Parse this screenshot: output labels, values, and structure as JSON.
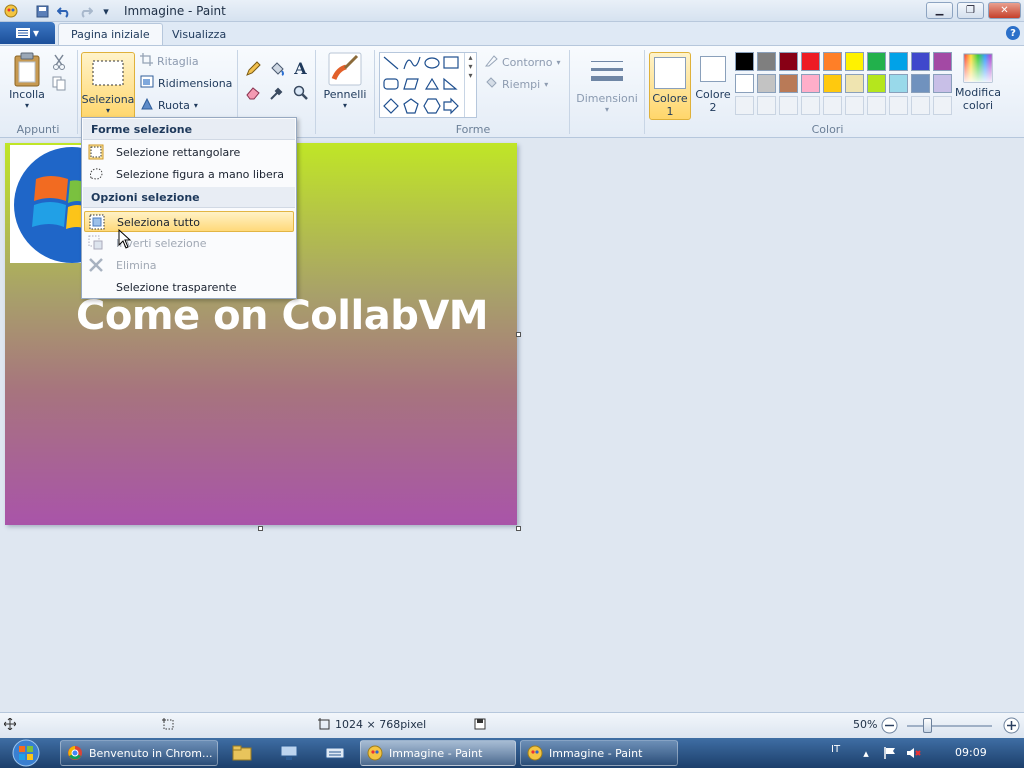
{
  "window": {
    "title": "Immagine - Paint"
  },
  "tabs": {
    "home": "Pagina iniziale",
    "view": "Visualizza"
  },
  "ribbon": {
    "clipboard": {
      "paste": "Incolla",
      "group": "Appunti"
    },
    "image": {
      "select": "Seleziona",
      "crop": "Ritaglia",
      "resize": "Ridimensiona",
      "rotate": "Ruota"
    },
    "tools": {
      "brushes": "Pennelli"
    },
    "shapes": {
      "outline": "Contorno",
      "fill": "Riempi",
      "group": "Forme"
    },
    "size": {
      "label": "Dimensioni"
    },
    "colors": {
      "color1_a": "Colore",
      "color1_b": "1",
      "color2_a": "Colore",
      "color2_b": "2",
      "edit_a": "Modifica",
      "edit_b": "colori",
      "group": "Colori"
    },
    "palette": [
      "#000000",
      "#7f7f7f",
      "#880015",
      "#ed1c24",
      "#ff7f27",
      "#fff200",
      "#22b14c",
      "#00a2e8",
      "#3f48cc",
      "#a349a4",
      "#ffffff",
      "#c3c3c3",
      "#b97a57",
      "#ffaec9",
      "#ffc90e",
      "#efe4b0",
      "#b5e61d",
      "#99d9ea",
      "#7092be",
      "#c8bfe7"
    ]
  },
  "dropdown": {
    "header_shapes": "Forme selezione",
    "rect": "Selezione rettangolare",
    "free": "Selezione figura a mano libera",
    "header_options": "Opzioni selezione",
    "all": "Seleziona tutto",
    "invert": "Inverti selezione",
    "delete": "Elimina",
    "transparent": "Selezione trasparente"
  },
  "canvas": {
    "text": "Come on CollabVM"
  },
  "status": {
    "dimensions": "1024 × 768pixel",
    "zoom": "50%"
  },
  "taskbar": {
    "chrome": "Benvenuto in Chrom...",
    "paint1": "Immagine - Paint",
    "paint2": "Immagine - Paint",
    "lang": "IT",
    "clock": "09:09"
  }
}
